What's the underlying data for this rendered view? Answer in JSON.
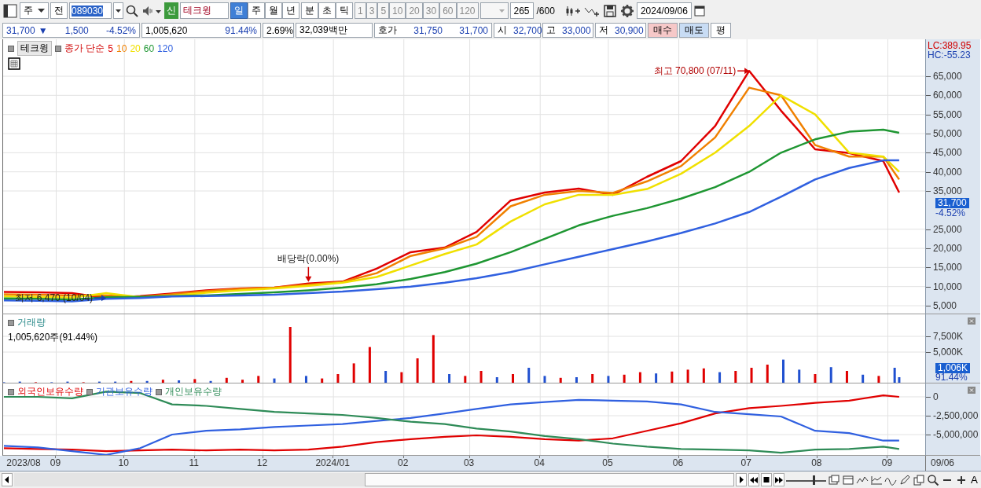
{
  "toolbar": {
    "market_dropdown": "주",
    "type_label": "전",
    "stock_code": "089030",
    "market_badge": "신",
    "stock_name": "테크윙",
    "period_buttons": [
      {
        "label": "일",
        "selected": true
      },
      {
        "label": "주",
        "selected": false
      },
      {
        "label": "월",
        "selected": false
      },
      {
        "label": "년",
        "selected": false
      },
      {
        "label": "분",
        "selected": false
      },
      {
        "label": "초",
        "selected": false
      },
      {
        "label": "틱",
        "selected": false
      }
    ],
    "interval_buttons": [
      "1",
      "3",
      "5",
      "10",
      "20",
      "30",
      "60",
      "120"
    ],
    "count": "265",
    "max_count": "/600",
    "date": "2024/09/06"
  },
  "quote": {
    "price": "31,700",
    "direction": "▼",
    "change": "1,500",
    "change_rate": "-4.52%",
    "volume": "1,005,620",
    "volume_ratio": "91.44%",
    "turnover": "2.69%",
    "amount": "32,039백만",
    "ask_label": "호가",
    "ask": "31,750",
    "bid": "31,700",
    "open_label": "시",
    "open": "32,700",
    "high_label": "고",
    "high": "33,000",
    "low_label": "저",
    "low": "30,900",
    "buy_button": "매수",
    "sell_button": "매도",
    "avg_button": "평"
  },
  "price_pane": {
    "stock_tab": "테크윙",
    "legend_label": "종가 단순",
    "lc": "LC:389.95",
    "hc": "HC:-55.23",
    "price_tag": "31,700",
    "change_tag": "-4.52%",
    "chart_data": {
      "type": "line",
      "x": [
        "2023-08-09",
        "2023-08-24",
        "2023-09-08",
        "2023-09-23",
        "2023-10-08",
        "2023-10-22",
        "2023-11-06",
        "2023-11-21",
        "2023-12-06",
        "2023-12-21",
        "2024-01-05",
        "2024-01-20",
        "2024-02-04",
        "2024-02-19",
        "2024-03-04",
        "2024-03-19",
        "2024-04-03",
        "2024-04-18",
        "2024-05-03",
        "2024-05-18",
        "2024-06-02",
        "2024-06-17",
        "2024-07-02",
        "2024-07-16",
        "2024-07-31",
        "2024-08-15",
        "2024-08-30",
        "2024-09-06"
      ],
      "xlim": [
        "2023-08-09",
        "2024-10-12"
      ],
      "ylim": [
        2740,
        74660
      ],
      "yticks": [
        {
          "value": 5000,
          "label": "5,000"
        },
        {
          "value": 10000,
          "label": "10,000"
        },
        {
          "value": 15000,
          "label": "15,000"
        },
        {
          "value": 20000,
          "label": "20,000"
        },
        {
          "value": 25000,
          "label": "25,000"
        },
        {
          "value": 35000,
          "label": "35,000"
        },
        {
          "value": 40000,
          "label": "40,000"
        },
        {
          "value": 45000,
          "label": "45,000"
        },
        {
          "value": 50000,
          "label": "50,000"
        },
        {
          "value": 55000,
          "label": "55,000"
        },
        {
          "value": 60000,
          "label": "60,000"
        },
        {
          "value": 65000,
          "label": "65,000"
        }
      ],
      "series": [
        {
          "name": "5",
          "color": "#e00000",
          "values": [
            8600,
            8500,
            8300,
            7000,
            7500,
            8200,
            9000,
            9500,
            9700,
            10800,
            11300,
            14700,
            19000,
            20200,
            24300,
            32500,
            34600,
            35600,
            34000,
            38700,
            42800,
            52000,
            66400,
            56000,
            45900,
            44900,
            42800,
            34600
          ]
        },
        {
          "name": "10",
          "color": "#f08000",
          "values": [
            8000,
            7900,
            7700,
            7700,
            7300,
            8000,
            8800,
            9400,
            9700,
            10500,
            11200,
            13500,
            18000,
            20000,
            23000,
            31000,
            34000,
            35000,
            34500,
            37500,
            41500,
            49000,
            62000,
            60000,
            47000,
            44000,
            44000,
            38000
          ]
        },
        {
          "name": "20",
          "color": "#f0e000",
          "values": [
            7400,
            7300,
            7100,
            8300,
            7200,
            7600,
            8400,
            9000,
            9500,
            10200,
            11000,
            12500,
            15500,
            18500,
            21000,
            27000,
            31500,
            34000,
            34000,
            35500,
            39500,
            45000,
            52000,
            60000,
            55000,
            45000,
            44000,
            40000
          ]
        },
        {
          "name": "60",
          "color": "#1e9632",
          "values": [
            6900,
            6800,
            6600,
            7200,
            7300,
            7500,
            7700,
            8100,
            8500,
            9000,
            9700,
            10600,
            12000,
            13800,
            16000,
            19000,
            22500,
            26000,
            28500,
            30500,
            33000,
            36000,
            40000,
            45000,
            48500,
            50500,
            51000,
            50200
          ]
        },
        {
          "name": "120",
          "color": "#3060e0",
          "values": [
            6400,
            6300,
            6100,
            6800,
            7000,
            7400,
            7500,
            7700,
            7900,
            8300,
            8700,
            9300,
            10000,
            11000,
            12200,
            13800,
            15800,
            17800,
            19800,
            21800,
            24000,
            26500,
            29500,
            33500,
            38000,
            41000,
            43000,
            43000
          ]
        }
      ],
      "grid": true,
      "annotations": [
        {
          "x": "2024-07-02",
          "y": 66400,
          "text": "최고 70,800 (07/11)"
        },
        {
          "x": "2023-09-23",
          "y": 7000,
          "text": "최저 6,470 (10/04)"
        },
        {
          "x": "2023-12-21",
          "y": 10800,
          "text": "배당락(0.00%)"
        }
      ]
    }
  },
  "volume_pane": {
    "title": "거래량",
    "reading": "1,005,620주(91.44%)",
    "value_tag": "1,006K",
    "ratio_tag": "91.44%",
    "chart_data": {
      "type": "bar",
      "x": [
        "2023-08-09",
        "2023-08-16",
        "2023-08-23",
        "2023-08-30",
        "2023-09-06",
        "2023-09-13",
        "2023-09-20",
        "2023-09-27",
        "2023-10-04",
        "2023-10-11",
        "2023-10-18",
        "2023-10-25",
        "2023-11-01",
        "2023-11-08",
        "2023-11-15",
        "2023-11-22",
        "2023-11-29",
        "2023-12-06",
        "2023-12-13",
        "2023-12-20",
        "2023-12-27",
        "2024-01-03",
        "2024-01-10",
        "2024-01-17",
        "2024-01-24",
        "2024-01-31",
        "2024-02-07",
        "2024-02-14",
        "2024-02-21",
        "2024-02-28",
        "2024-03-06",
        "2024-03-13",
        "2024-03-20",
        "2024-03-27",
        "2024-04-03",
        "2024-04-10",
        "2024-04-17",
        "2024-04-24",
        "2024-05-01",
        "2024-05-08",
        "2024-05-15",
        "2024-05-22",
        "2024-05-29",
        "2024-06-05",
        "2024-06-12",
        "2024-06-19",
        "2024-06-26",
        "2024-07-03",
        "2024-07-10",
        "2024-07-17",
        "2024-07-24",
        "2024-07-31",
        "2024-08-07",
        "2024-08-14",
        "2024-08-21",
        "2024-08-28",
        "2024-09-04",
        "2024-09-06"
      ],
      "xlim": [
        "2023-08-09",
        "2024-10-12"
      ],
      "ylim": [
        0,
        11000
      ],
      "yticks": [
        {
          "value": 5000,
          "label": "5,000K"
        },
        {
          "value": 7500,
          "label": "7,500K"
        }
      ],
      "grid": true,
      "stacked": true,
      "series": [
        {
          "color": "#e00000",
          "values": [
            null,
            null,
            200,
            null,
            null,
            200,
            null,
            null,
            400,
            null,
            600,
            null,
            700,
            null,
            900,
            600,
            1200,
            null,
            9000,
            null,
            800,
            1500,
            3200,
            5800,
            null,
            1800,
            4000,
            7700,
            null,
            1200,
            2000,
            null,
            1500,
            null,
            null,
            900,
            null,
            1500,
            null,
            1400,
            1800,
            null,
            1900,
            2200,
            2400,
            null,
            2000,
            2500,
            3000,
            null,
            null,
            1500,
            null,
            2000,
            null,
            1200,
            null,
            null
          ]
        },
        {
          "color": "#2050d0",
          "values": [
            200,
            300,
            null,
            200,
            300,
            null,
            300,
            300,
            null,
            400,
            null,
            500,
            null,
            400,
            null,
            null,
            null,
            800,
            null,
            1200,
            null,
            null,
            null,
            null,
            2000,
            null,
            null,
            null,
            1500,
            null,
            null,
            1000,
            null,
            2500,
            1200,
            null,
            1000,
            null,
            1200,
            null,
            null,
            1600,
            null,
            null,
            null,
            1800,
            null,
            null,
            null,
            3800,
            2200,
            null,
            2600,
            null,
            1400,
            null,
            2500,
            1000
          ]
        }
      ]
    }
  },
  "holdings_pane": {
    "chart_data": {
      "type": "line",
      "x": [
        "2023-08-09",
        "2023-08-24",
        "2023-09-08",
        "2023-09-23",
        "2023-10-08",
        "2023-10-22",
        "2023-11-06",
        "2023-11-21",
        "2023-12-06",
        "2023-12-21",
        "2024-01-05",
        "2024-01-20",
        "2024-02-04",
        "2024-02-19",
        "2024-03-04",
        "2024-03-19",
        "2024-04-03",
        "2024-04-18",
        "2024-05-03",
        "2024-05-18",
        "2024-06-02",
        "2024-06-17",
        "2024-07-02",
        "2024-07-16",
        "2024-07-31",
        "2024-08-15",
        "2024-08-30",
        "2024-09-06"
      ],
      "xlim": [
        "2023-08-09",
        "2024-10-12"
      ],
      "ylim": [
        -7810000,
        1770000
      ],
      "yticks": [
        {
          "value": 0,
          "label": "0"
        },
        {
          "value": -2500000,
          "label": "-2,500,000"
        },
        {
          "value": -5000000,
          "label": "-5,000,000"
        }
      ],
      "grid": true,
      "xticks": [
        {
          "value": "2023-08-18",
          "label": "2023/08"
        },
        {
          "value": "2023-09-01",
          "label": "09"
        },
        {
          "value": "2023-10-01",
          "label": "10"
        },
        {
          "value": "2023-11-01",
          "label": "11"
        },
        {
          "value": "2023-12-01",
          "label": "12"
        },
        {
          "value": "2024-01-01",
          "label": "2024/01"
        },
        {
          "value": "2024-02-01",
          "label": "02"
        },
        {
          "value": "2024-03-01",
          "label": "03"
        },
        {
          "value": "2024-04-01",
          "label": "04"
        },
        {
          "value": "2024-05-01",
          "label": "05"
        },
        {
          "value": "2024-06-01",
          "label": "06"
        },
        {
          "value": "2024-07-01",
          "label": "07"
        },
        {
          "value": "2024-08-01",
          "label": "08"
        },
        {
          "value": "2024-09-01",
          "label": "09"
        }
      ],
      "series": [
        {
          "name": "외국인보유수량",
          "color": "#e00000",
          "values": [
            -6800000,
            -6900000,
            -7000000,
            -7200000,
            -7100000,
            -7000000,
            -7100000,
            -7000000,
            -7100000,
            -7000000,
            -6600000,
            -6000000,
            -5600000,
            -5300000,
            -5100000,
            -5300000,
            -5600000,
            -5800000,
            -5500000,
            -4500000,
            -3500000,
            -2200000,
            -1500000,
            -1200000,
            -800000,
            -500000,
            200000,
            0
          ]
        },
        {
          "name": "기관보유수량",
          "color": "#3060e0",
          "values": [
            -6500000,
            -6700000,
            -7200000,
            -7700000,
            -6800000,
            -5000000,
            -4500000,
            -4300000,
            -4000000,
            -3800000,
            -3600000,
            -3200000,
            -2800000,
            -2200000,
            -1600000,
            -1000000,
            -700000,
            -400000,
            -500000,
            -600000,
            -1000000,
            -2000000,
            -2300000,
            -2600000,
            -4500000,
            -4800000,
            -5800000,
            -5800000
          ]
        },
        {
          "name": "개인보유수량",
          "color": "#2e8b57",
          "values": [
            0,
            0,
            -200000,
            700000,
            500000,
            -1000000,
            -1200000,
            -1600000,
            -2000000,
            -2200000,
            -2400000,
            -2800000,
            -3300000,
            -3600000,
            -4200000,
            -4600000,
            -5200000,
            -5600000,
            -6200000,
            -6600000,
            -6900000,
            -7000000,
            -7100000,
            -7400000,
            -7000000,
            -6900000,
            -6600000,
            -6900000
          ]
        }
      ]
    }
  },
  "time_axis": {
    "end_date": "09/06"
  },
  "scroll": {
    "font_button": "A"
  }
}
